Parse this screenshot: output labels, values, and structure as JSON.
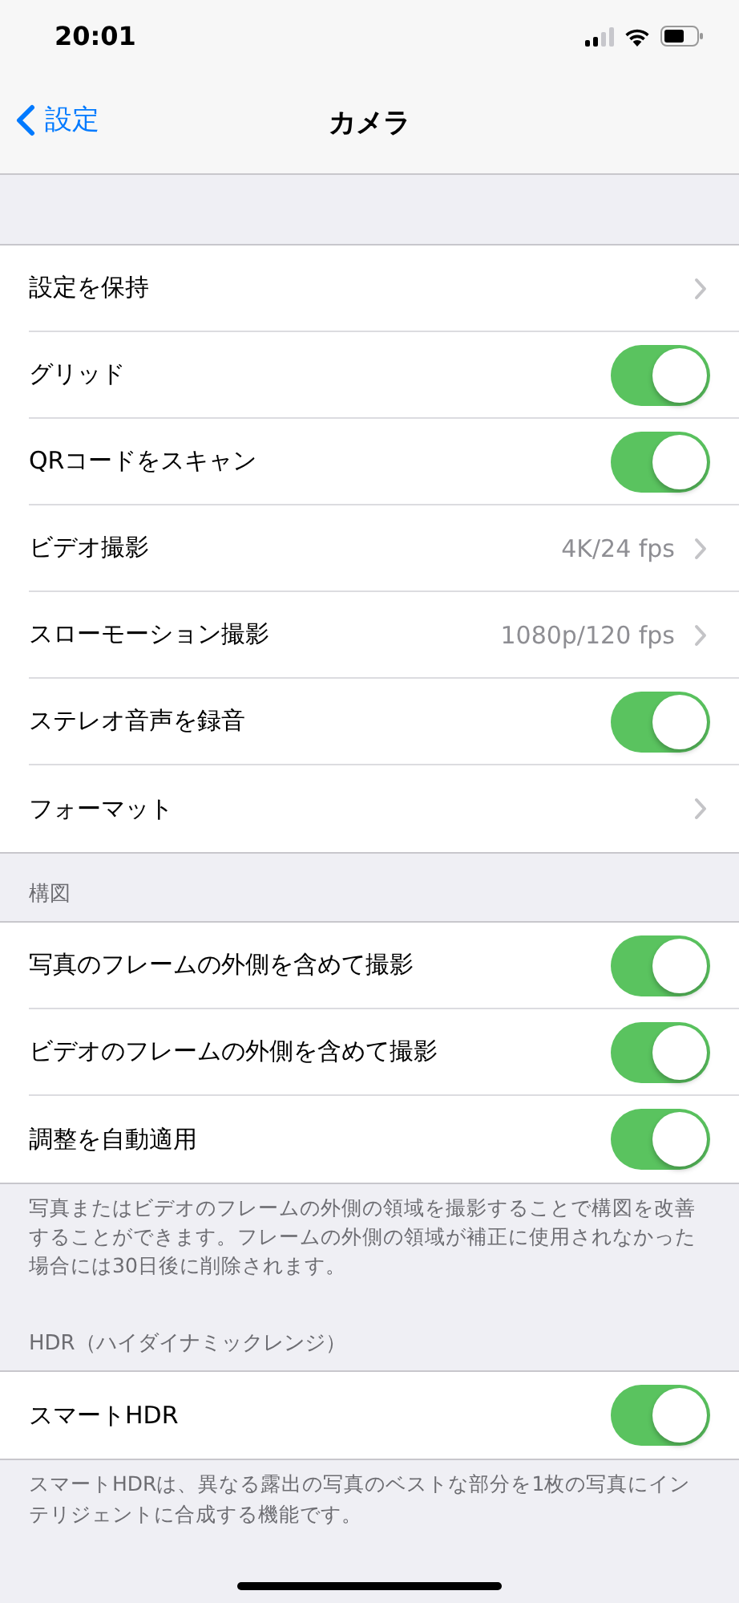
{
  "status_bar": {
    "time": "20:01"
  },
  "nav": {
    "back_label": "設定",
    "title": "カメラ"
  },
  "sections": [
    {
      "rows": [
        {
          "kind": "link",
          "label": "設定を保持"
        },
        {
          "kind": "toggle",
          "label": "グリッド",
          "on": true
        },
        {
          "kind": "toggle",
          "label": "QRコードをスキャン",
          "on": true
        },
        {
          "kind": "link",
          "label": "ビデオ撮影",
          "value": "4K/24 fps"
        },
        {
          "kind": "link",
          "label": "スローモーション撮影",
          "value": "1080p/120 fps"
        },
        {
          "kind": "toggle",
          "label": "ステレオ音声を録音",
          "on": true
        },
        {
          "kind": "link",
          "label": "フォーマット"
        }
      ]
    },
    {
      "header": "構図",
      "rows": [
        {
          "kind": "toggle",
          "label": "写真のフレームの外側を含めて撮影",
          "on": true
        },
        {
          "kind": "toggle",
          "label": "ビデオのフレームの外側を含めて撮影",
          "on": true
        },
        {
          "kind": "toggle",
          "label": "調整を自動適用",
          "on": true
        }
      ],
      "footer": "写真またはビデオのフレームの外側の領域を撮影することで構図を改善することができます。フレームの外側の領域が補正に使用されなかった場合には30日後に削除されます。"
    },
    {
      "header": "HDR（ハイダイナミックレンジ）",
      "rows": [
        {
          "kind": "toggle",
          "label": "スマートHDR",
          "on": true
        }
      ],
      "footer": "スマートHDRは、異なる露出の写真のベストな部分を1枚の写真にインテリジェントに合成する機能です。"
    }
  ]
}
